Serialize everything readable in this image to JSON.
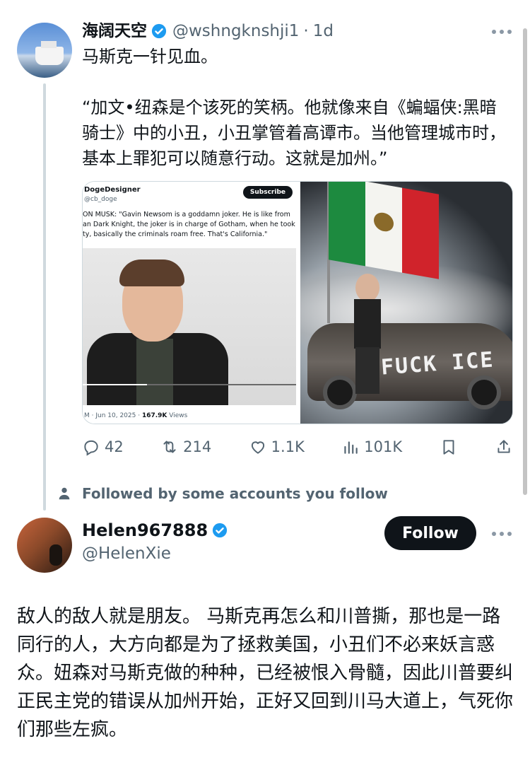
{
  "tweet1": {
    "name": "海阔天空",
    "handle": "@wshngknshji1",
    "separator": "·",
    "time": "1d",
    "text": "马斯克一针见血。\n\n“加文•纽森是个该死的笑柄。他就像来自《蝙蝠侠:黑暗骑士》中的小丑，小丑掌管着高谭市。当他管理城市时，基本上罪犯可以随意行动。这就是加州。”",
    "verified_icon": "verified-badge-icon",
    "media": {
      "left_screenshot": {
        "author": "DogeDesigner",
        "handle": "@cb_doge",
        "subscribe_label": "Subscribe",
        "quote": "ON MUSK: \"Gavin Newsom is a goddamn joker. He is like from an Dark Knight, the joker is in charge of Gotham, when he took ty, basically the criminals roam free. That's California.\"",
        "footer_date": "M · Jun 10, 2025 ·",
        "footer_views": "167.9K",
        "footer_views_label": "Views",
        "video_progress": 0.3
      },
      "right_image": {
        "flag_text": "MEXICO",
        "graffiti": "FUCK ICE"
      }
    },
    "actions": {
      "replies": "42",
      "retweets": "214",
      "likes": "1.1K",
      "views": "101K"
    }
  },
  "followed_notice": "Followed by some accounts you follow",
  "tweet2": {
    "name": "Helen967888",
    "handle": "@HelenXie",
    "follow_label": "Follow",
    "text": "敌人的敌人就是朋友。 马斯克再怎么和川普撕，那也是一路同行的人，大方向都是为了拯救美国，小丑们不必来妖言惑众。妞森对马斯克做的种种，已经被恨入骨髓，因此川普要纠正民主党的错误从加州开始，正好又回到川马大道上，气死你们那些左疯。"
  },
  "colors": {
    "text": "#0f1419",
    "secondary": "#536471",
    "verified": "#1d9bf0",
    "button": "#0f1419"
  }
}
